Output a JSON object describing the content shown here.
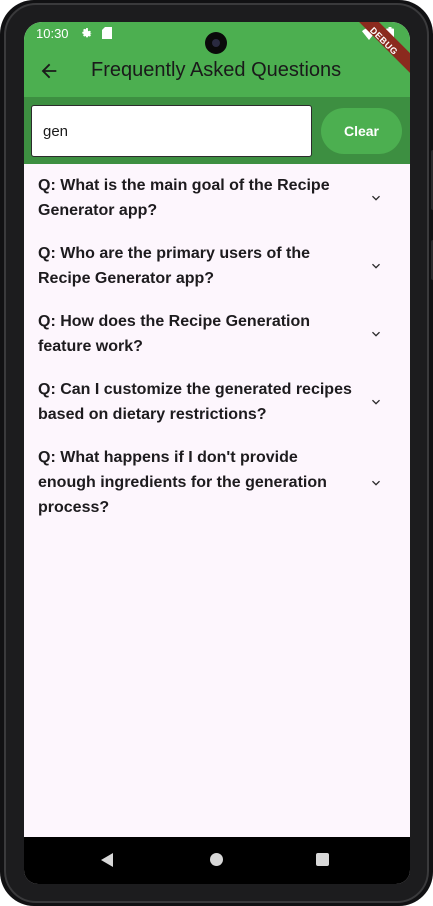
{
  "status_bar": {
    "time": "10:30",
    "icons": [
      "gear-icon",
      "sd-card-icon",
      "wifi-icon",
      "battery-icon"
    ]
  },
  "app_bar": {
    "title": "Frequently Asked Questions",
    "back_icon": "arrow-left-icon"
  },
  "debug_banner": "DEBUG",
  "search": {
    "value": "gen",
    "clear_label": "Clear"
  },
  "faq": [
    {
      "question": "Q: What is the main goal of the Recipe Generator app?"
    },
    {
      "question": "Q: Who are the primary users of the Recipe Generator app?"
    },
    {
      "question": "Q: How does the Recipe Generation feature work?"
    },
    {
      "question": "Q: Can I customize the generated recipes based on dietary restrictions?"
    },
    {
      "question": "Q: What happens if I don't provide enough ingredients for the generation process?"
    }
  ],
  "nav_bar": {
    "icons": [
      "back-triangle-icon",
      "home-circle-icon",
      "recents-square-icon"
    ]
  },
  "colors": {
    "primary": "#4caf50",
    "search_bg": "#3d8f41",
    "list_bg": "#fdf6fd",
    "debug_banner": "#8b2a1e"
  }
}
